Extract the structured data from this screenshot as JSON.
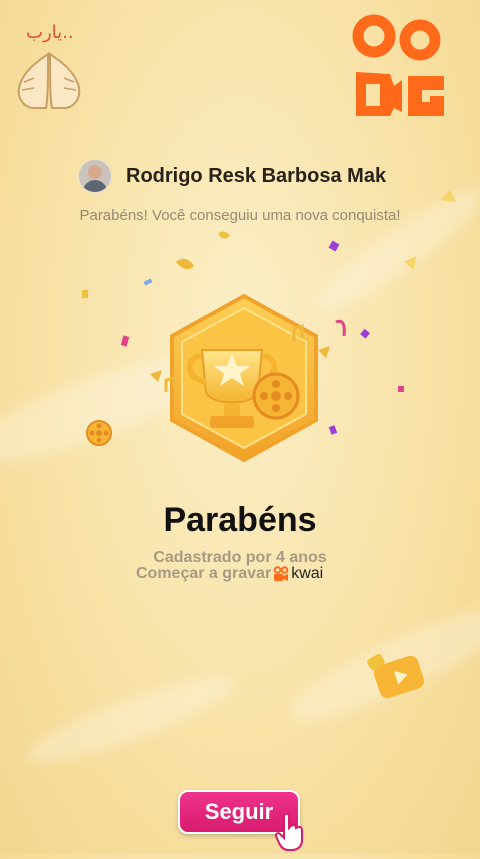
{
  "profile": {
    "name": "Rodrigo Resk Barbosa Mak"
  },
  "message": {
    "subtitle": "Parabéns! Você conseguiu uma nova conquista!"
  },
  "achievement": {
    "headline": "Parabéns",
    "line1": "Cadastrado por 4 anos",
    "line2_prefix": "Começar a gravar",
    "brand": "kwai"
  },
  "watermark": {
    "arabic_text": "يارب.."
  },
  "actions": {
    "follow_label": "Seguir"
  },
  "colors": {
    "kwai_orange": "#ff6a1a",
    "follow_pink": "#e52479",
    "background": "#f8e2a6"
  }
}
